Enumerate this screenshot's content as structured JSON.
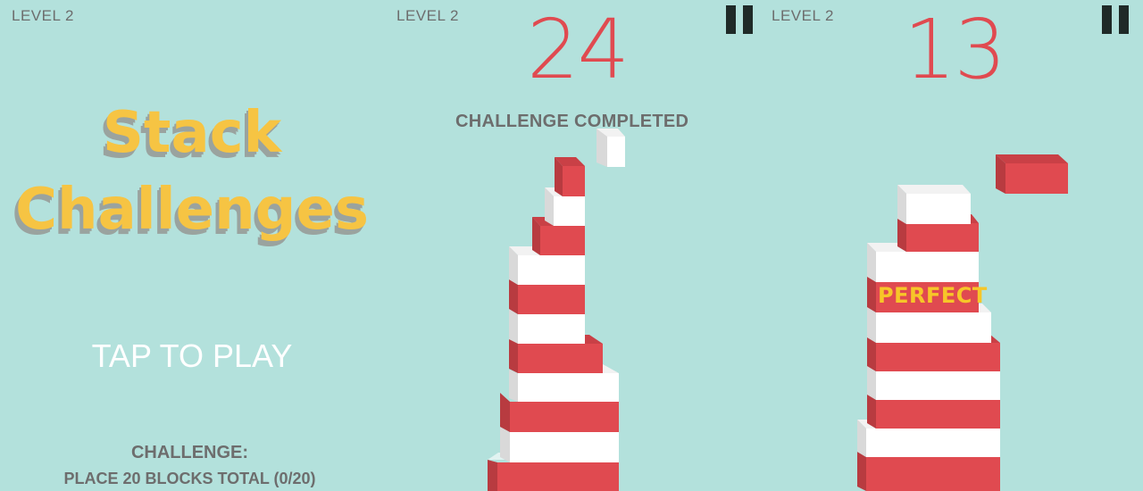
{
  "panels": {
    "menu": {
      "level": "LEVEL 2",
      "title_line1": "Stack",
      "title_line2": "Challenges",
      "tap_to_play": "TAP TO PLAY",
      "challenge_heading": "CHALLENGE:",
      "challenge_text": "PLACE 20 BLOCKS TOTAL (0/20)"
    },
    "game1": {
      "level": "LEVEL 2",
      "score": "24",
      "status": "CHALLENGE COMPLETED"
    },
    "game2": {
      "level": "LEVEL 2",
      "score": "13",
      "feedback": "PERFECT"
    }
  },
  "colors": {
    "background": "#b3e1dc",
    "red_block": "#e04a50",
    "white_block": "#ffffff",
    "title": "#f6c443",
    "score": "#e04a50"
  },
  "icons": {
    "pause": "pause-icon"
  }
}
